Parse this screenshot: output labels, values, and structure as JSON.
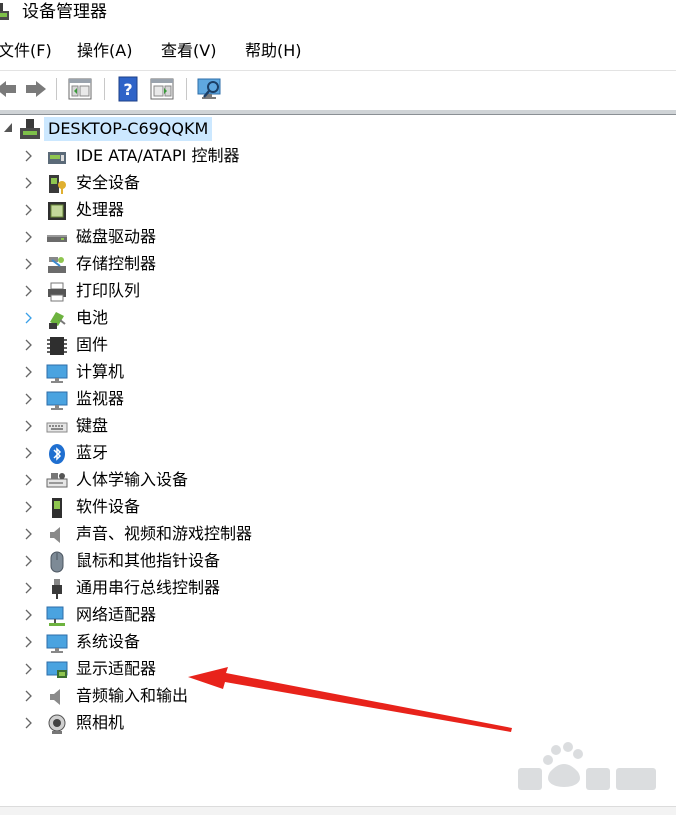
{
  "window": {
    "title": "设备管理器"
  },
  "menu": [
    {
      "label": "文件(F)"
    },
    {
      "label": "操作(A)"
    },
    {
      "label": "查看(V)"
    },
    {
      "label": "帮助(H)"
    }
  ],
  "toolbar": {
    "buttons": [
      "back-icon",
      "forward-icon",
      "properties-icon",
      "help-icon",
      "update-driver-icon",
      "scan-hardware-icon"
    ]
  },
  "tree": {
    "root": {
      "label": "DESKTOP-C69QQKM",
      "icon": "computer-icon"
    },
    "nodes": [
      {
        "label": "IDE ATA/ATAPI 控制器",
        "icon": "ide-controller-icon"
      },
      {
        "label": "安全设备",
        "icon": "security-device-icon"
      },
      {
        "label": "处理器",
        "icon": "processor-icon"
      },
      {
        "label": "磁盘驱动器",
        "icon": "disk-drive-icon"
      },
      {
        "label": "存储控制器",
        "icon": "storage-controller-icon"
      },
      {
        "label": "打印队列",
        "icon": "printer-icon"
      },
      {
        "label": "电池",
        "icon": "battery-icon"
      },
      {
        "label": "固件",
        "icon": "firmware-icon"
      },
      {
        "label": "计算机",
        "icon": "computer-monitor-icon"
      },
      {
        "label": "监视器",
        "icon": "monitor-icon"
      },
      {
        "label": "键盘",
        "icon": "keyboard-icon"
      },
      {
        "label": "蓝牙",
        "icon": "bluetooth-icon"
      },
      {
        "label": "人体学输入设备",
        "icon": "hid-icon"
      },
      {
        "label": "软件设备",
        "icon": "software-device-icon"
      },
      {
        "label": "声音、视频和游戏控制器",
        "icon": "audio-icon"
      },
      {
        "label": "鼠标和其他指针设备",
        "icon": "mouse-icon"
      },
      {
        "label": "通用串行总线控制器",
        "icon": "usb-icon"
      },
      {
        "label": "网络适配器",
        "icon": "network-adapter-icon"
      },
      {
        "label": "系统设备",
        "icon": "system-device-icon"
      },
      {
        "label": "显示适配器",
        "icon": "display-adapter-icon"
      },
      {
        "label": "音频输入和输出",
        "icon": "audio-io-icon"
      },
      {
        "label": "照相机",
        "icon": "camera-icon"
      }
    ]
  },
  "colors": {
    "selection": "#cce8ff",
    "annotation_arrow": "#e8231b"
  }
}
